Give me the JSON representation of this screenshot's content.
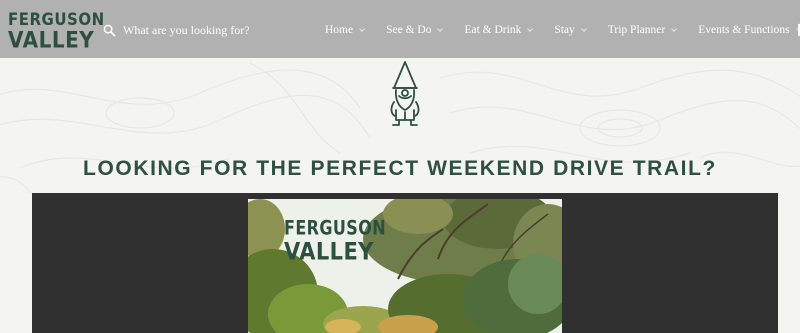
{
  "brand": {
    "logo_line1": "FERGUSON",
    "logo_line2": "VALLEY",
    "color": "#2d4f3f"
  },
  "search": {
    "placeholder": "What are you looking for?",
    "icon": "search-icon"
  },
  "nav": {
    "items": [
      {
        "label": "Home"
      },
      {
        "label": "See & Do"
      },
      {
        "label": "Eat & Drink"
      },
      {
        "label": "Stay"
      },
      {
        "label": "Trip Planner"
      },
      {
        "label": "Events & Functions"
      }
    ]
  },
  "hero": {
    "icon": "gnome-icon",
    "headline": "LOOKING FOR THE PERFECT WEEKEND DRIVE TRAIL?",
    "image_logo_line1": "FERGUSON",
    "image_logo_line2": "VALLEY"
  },
  "colors": {
    "header_bg": "#b1b1b1",
    "accent_green": "#2f4f40",
    "panel_bg": "#303030",
    "page_bg": "#f4f4f2"
  }
}
